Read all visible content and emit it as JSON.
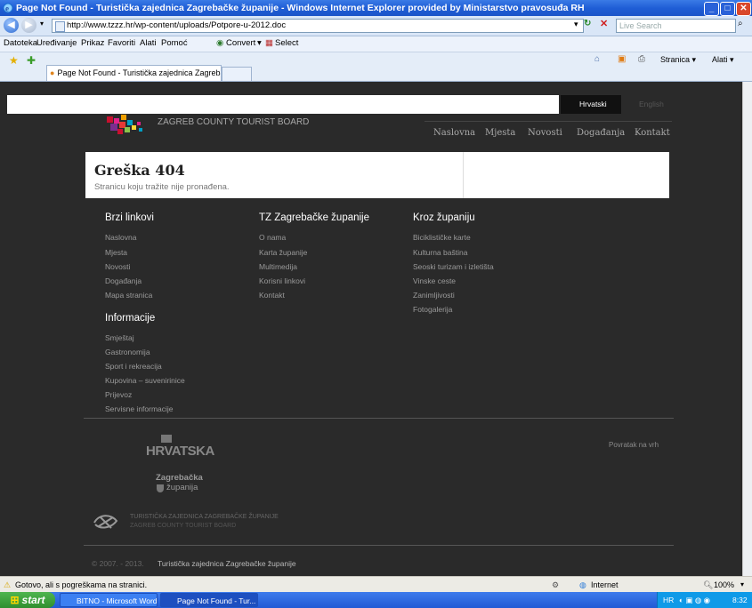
{
  "window": {
    "title": "Page Not Found - Turistička zajednica Zagrebačke županije - Windows Internet Explorer provided by Ministarstvo pravosuđa RH",
    "controls": {
      "minimize": "_",
      "maximize": "□",
      "close": "✕"
    }
  },
  "address_bar": {
    "url": "http://www.tzzz.hr/wp-content/uploads/Potpore-u-2012.doc",
    "search_placeholder": "Live Search"
  },
  "menu": {
    "items": [
      "Datoteka",
      "Uređivanje",
      "Prikaz",
      "Favoriti",
      "Alati",
      "Pomoć"
    ],
    "convert_label": "Convert",
    "select_label": "Select"
  },
  "tabs": {
    "active_label": "Page Not Found - Turistička zajednica Zagrebačke žup...",
    "right_tools": {
      "page": "Stranica",
      "tools": "Alati"
    }
  },
  "site": {
    "lang": {
      "active": "Hrvatski",
      "other": "English"
    },
    "logo_text": "ZAGREB COUNTY TOURIST BOARD",
    "nav": [
      "Naslovna",
      "Mjesta",
      "Novosti",
      "Događanja",
      "Kontakt"
    ],
    "error": {
      "title": "Greška 404",
      "subtitle": "Stranicu koju tražite nije pronađena."
    },
    "columns": [
      {
        "heading": "Brzi linkovi",
        "links": [
          "Naslovna",
          "Mjesta",
          "Novosti",
          "Događanja",
          "Mapa stranica"
        ]
      },
      {
        "heading": "TZ Zagrebačke županije",
        "links": [
          "O nama",
          "Karta županije",
          "Multimedija",
          "Korisni linkovi",
          "Kontakt"
        ]
      },
      {
        "heading": "Kroz županiju",
        "links": [
          "Biciklističke karte",
          "Kulturna baština",
          "Seoski turizam i izletišta",
          "Vinske ceste",
          "Zanimljivosti",
          "Fotogalerija"
        ]
      }
    ],
    "info": {
      "heading": "Informacije",
      "links": [
        "Smještaj",
        "Gastronomija",
        "Sport i rekreacija",
        "Kupovina – suveniri­nice",
        "Prijevoz",
        "Servisne informacije"
      ]
    },
    "logos": {
      "hrvatska": "HRVATSKA",
      "county_line1": "Zagrebačka",
      "county_line2": "županija",
      "tz_line1": "TURISTIČKA ZAJEDNICA ZAGREBAČKE ŽUPANIJE",
      "tz_line2": "ZAGREB COUNTY TOURIST BOARD"
    },
    "back_to_top": "Povratak na vrh",
    "copyright_years": "© 2007. - 2013.",
    "copyright_owner": "Turistička zajednica Zagrebačke županije"
  },
  "status_bar": {
    "message": "Gotovo, ali s pogreškama na stranici.",
    "zone": "Internet",
    "zoom": "100%"
  },
  "taskbar": {
    "start": "start",
    "items": [
      "BITNO - Microsoft Word",
      "Page Not Found - Tur..."
    ],
    "lang": "HR",
    "clock": "8:32"
  }
}
